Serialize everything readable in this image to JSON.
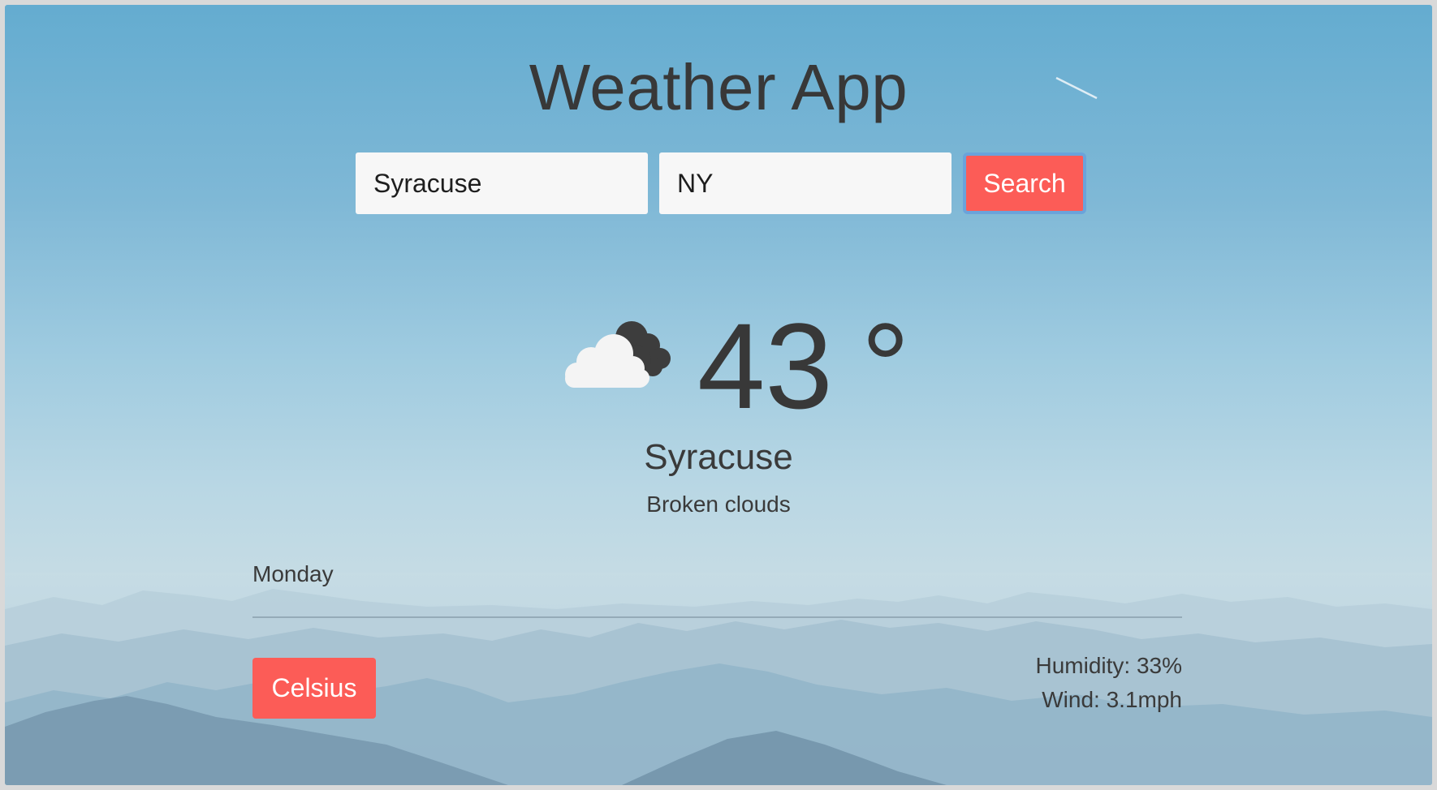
{
  "header": {
    "title": "Weather App"
  },
  "search": {
    "city_value": "Syracuse",
    "state_value": "NY",
    "button_label": "Search"
  },
  "current": {
    "icon": "broken-clouds-icon",
    "temperature": "43",
    "unit_symbol": " °",
    "city": "Syracuse",
    "description": "Broken clouds"
  },
  "forecast": {
    "day": "Monday"
  },
  "controls": {
    "unit_toggle_label": "Celsius"
  },
  "stats": {
    "humidity": "Humidity: 33%",
    "wind": "Wind: 3.1mph"
  },
  "colors": {
    "accent": "#fc5c57",
    "text": "#383838",
    "focus_ring": "#6aa3db"
  }
}
